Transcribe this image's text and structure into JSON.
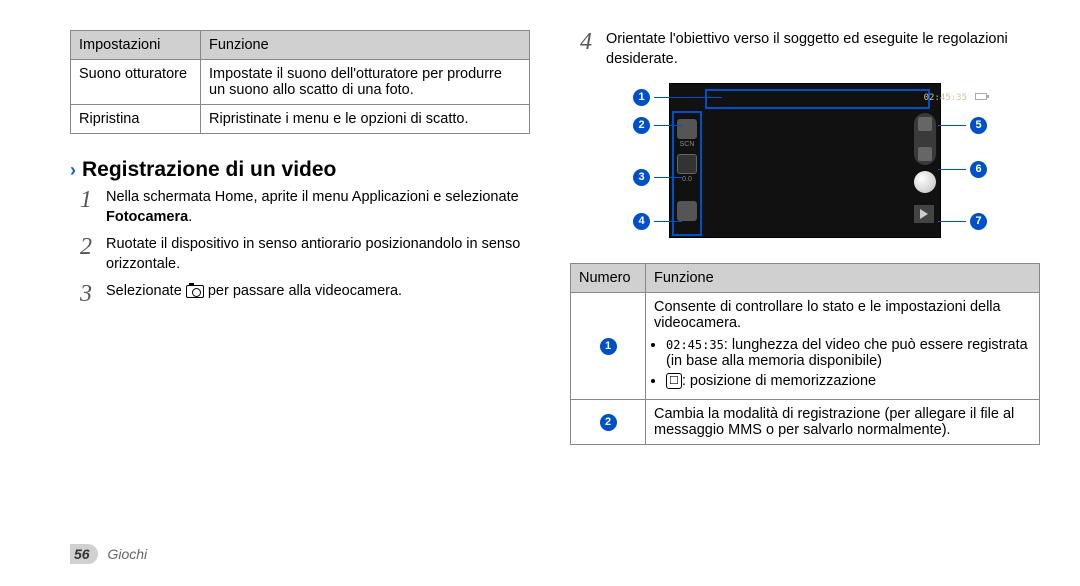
{
  "left_table": {
    "headers": [
      "Impostazioni",
      "Funzione"
    ],
    "rows": [
      {
        "setting": "Suono otturatore",
        "func": "Impostate il suono dell'otturatore per produrre un suono allo scatto di una foto."
      },
      {
        "setting": "Ripristina",
        "func": "Ripristinate i menu e le opzioni di scatto."
      }
    ]
  },
  "section": {
    "title": "Registrazione di un video",
    "steps": [
      {
        "n": "1",
        "text_pre": "Nella schermata Home, aprite il menu Applicazioni e selezionate ",
        "bold": "Fotocamera",
        "text_post": "."
      },
      {
        "n": "2",
        "text": "Ruotate il dispositivo in senso antiorario posizionandolo in senso orizzontale."
      },
      {
        "n": "3",
        "text_pre": "Selezionate ",
        "icon": "camera",
        "text_post": " per passare alla videocamera."
      }
    ]
  },
  "right_step": {
    "n": "4",
    "text": "Orientate l'obiettivo verso il soggetto ed eseguite le regolazioni desiderate."
  },
  "camera": {
    "timecode": "02:45:35",
    "scn_label": "SCN",
    "zero": "0.0"
  },
  "callouts": [
    "1",
    "2",
    "3",
    "4",
    "5",
    "6",
    "7"
  ],
  "right_table": {
    "headers": [
      "Numero",
      "Funzione"
    ],
    "rows": [
      {
        "num": "1",
        "main": "Consente di controllare lo stato e le impostazioni della videocamera.",
        "bullets": [
          {
            "mono": "02:45:35",
            "rest": ": lunghezza del video che può essere registrata (in base alla memoria disponibile)"
          },
          {
            "icon": "store",
            "rest": ": posizione di memorizzazione"
          }
        ]
      },
      {
        "num": "2",
        "main": "Cambia la modalità di registrazione (per allegare il file al messaggio MMS o per salvarlo normalmente)."
      }
    ]
  },
  "footer": {
    "page": "56",
    "section": "Giochi"
  }
}
